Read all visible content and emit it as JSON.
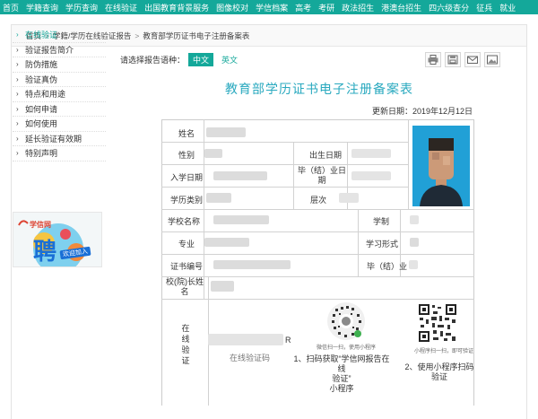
{
  "topnav": [
    "首页",
    "学籍查询",
    "学历查询",
    "在线验证",
    "出国教育背景服务",
    "图像校对",
    "学信档案",
    "高考",
    "考研",
    "政法招生",
    "港澳台招生",
    "四六级查分",
    "征兵",
    "就业"
  ],
  "breadcrumb": {
    "home": "首页",
    "section": "学籍/学历在线验证报告",
    "current": "教育部学历证书电子注册备案表",
    "sep": ">"
  },
  "sidebar": [
    {
      "label": "在线验证",
      "active": true
    },
    {
      "label": "验证报告简介"
    },
    {
      "label": "防伪措施"
    },
    {
      "label": "验证真伪"
    },
    {
      "label": "特点和用途"
    },
    {
      "label": "如何申请"
    },
    {
      "label": "如何使用"
    },
    {
      "label": "延长验证有效期"
    },
    {
      "label": "特别声明"
    }
  ],
  "banner": {
    "logo": "学信网",
    "big": "聘",
    "sub": "欢迎加入"
  },
  "lang": {
    "prompt": "请选择报告语种：",
    "zh": "中文",
    "en": "英文"
  },
  "tools": [
    "print-icon",
    "download-icon",
    "mail-icon",
    "image-icon"
  ],
  "report": {
    "title": "教育部学历证书电子注册备案表",
    "update": "更新日期：2019年12月12日",
    "labels": {
      "name": "姓名",
      "gender": "性别",
      "birth": "出生日期",
      "enroll": "入学日期",
      "grad": "毕（结）业日期",
      "grad_a": "毕（结）业日",
      "grad_b": "期",
      "type": "学历类别",
      "level": "层次",
      "school": "学校名称",
      "duration": "学制",
      "major": "专业",
      "form": "学习形式",
      "cert": "证书编号",
      "status": "毕（结）业",
      "principal_a": "校(院)长姓",
      "principal_b": "名",
      "online": [
        "在",
        "线",
        "验",
        "证"
      ]
    },
    "verify": {
      "code_label": "在线验证码",
      "code_suffix": "R",
      "qr1_caption": "微信扫一扫，使用小程序",
      "step1": [
        "1、扫码获取“学信网报告在线",
        "验证”",
        "小程序"
      ],
      "qr2_caption": "小程序扫一扫，即可验证",
      "step2": [
        "2、使用小程序扫码",
        "验证"
      ]
    }
  },
  "colors": {
    "accent": "#14a89a",
    "title": "#29a9bf",
    "photo_bg": "#21a0d6"
  }
}
